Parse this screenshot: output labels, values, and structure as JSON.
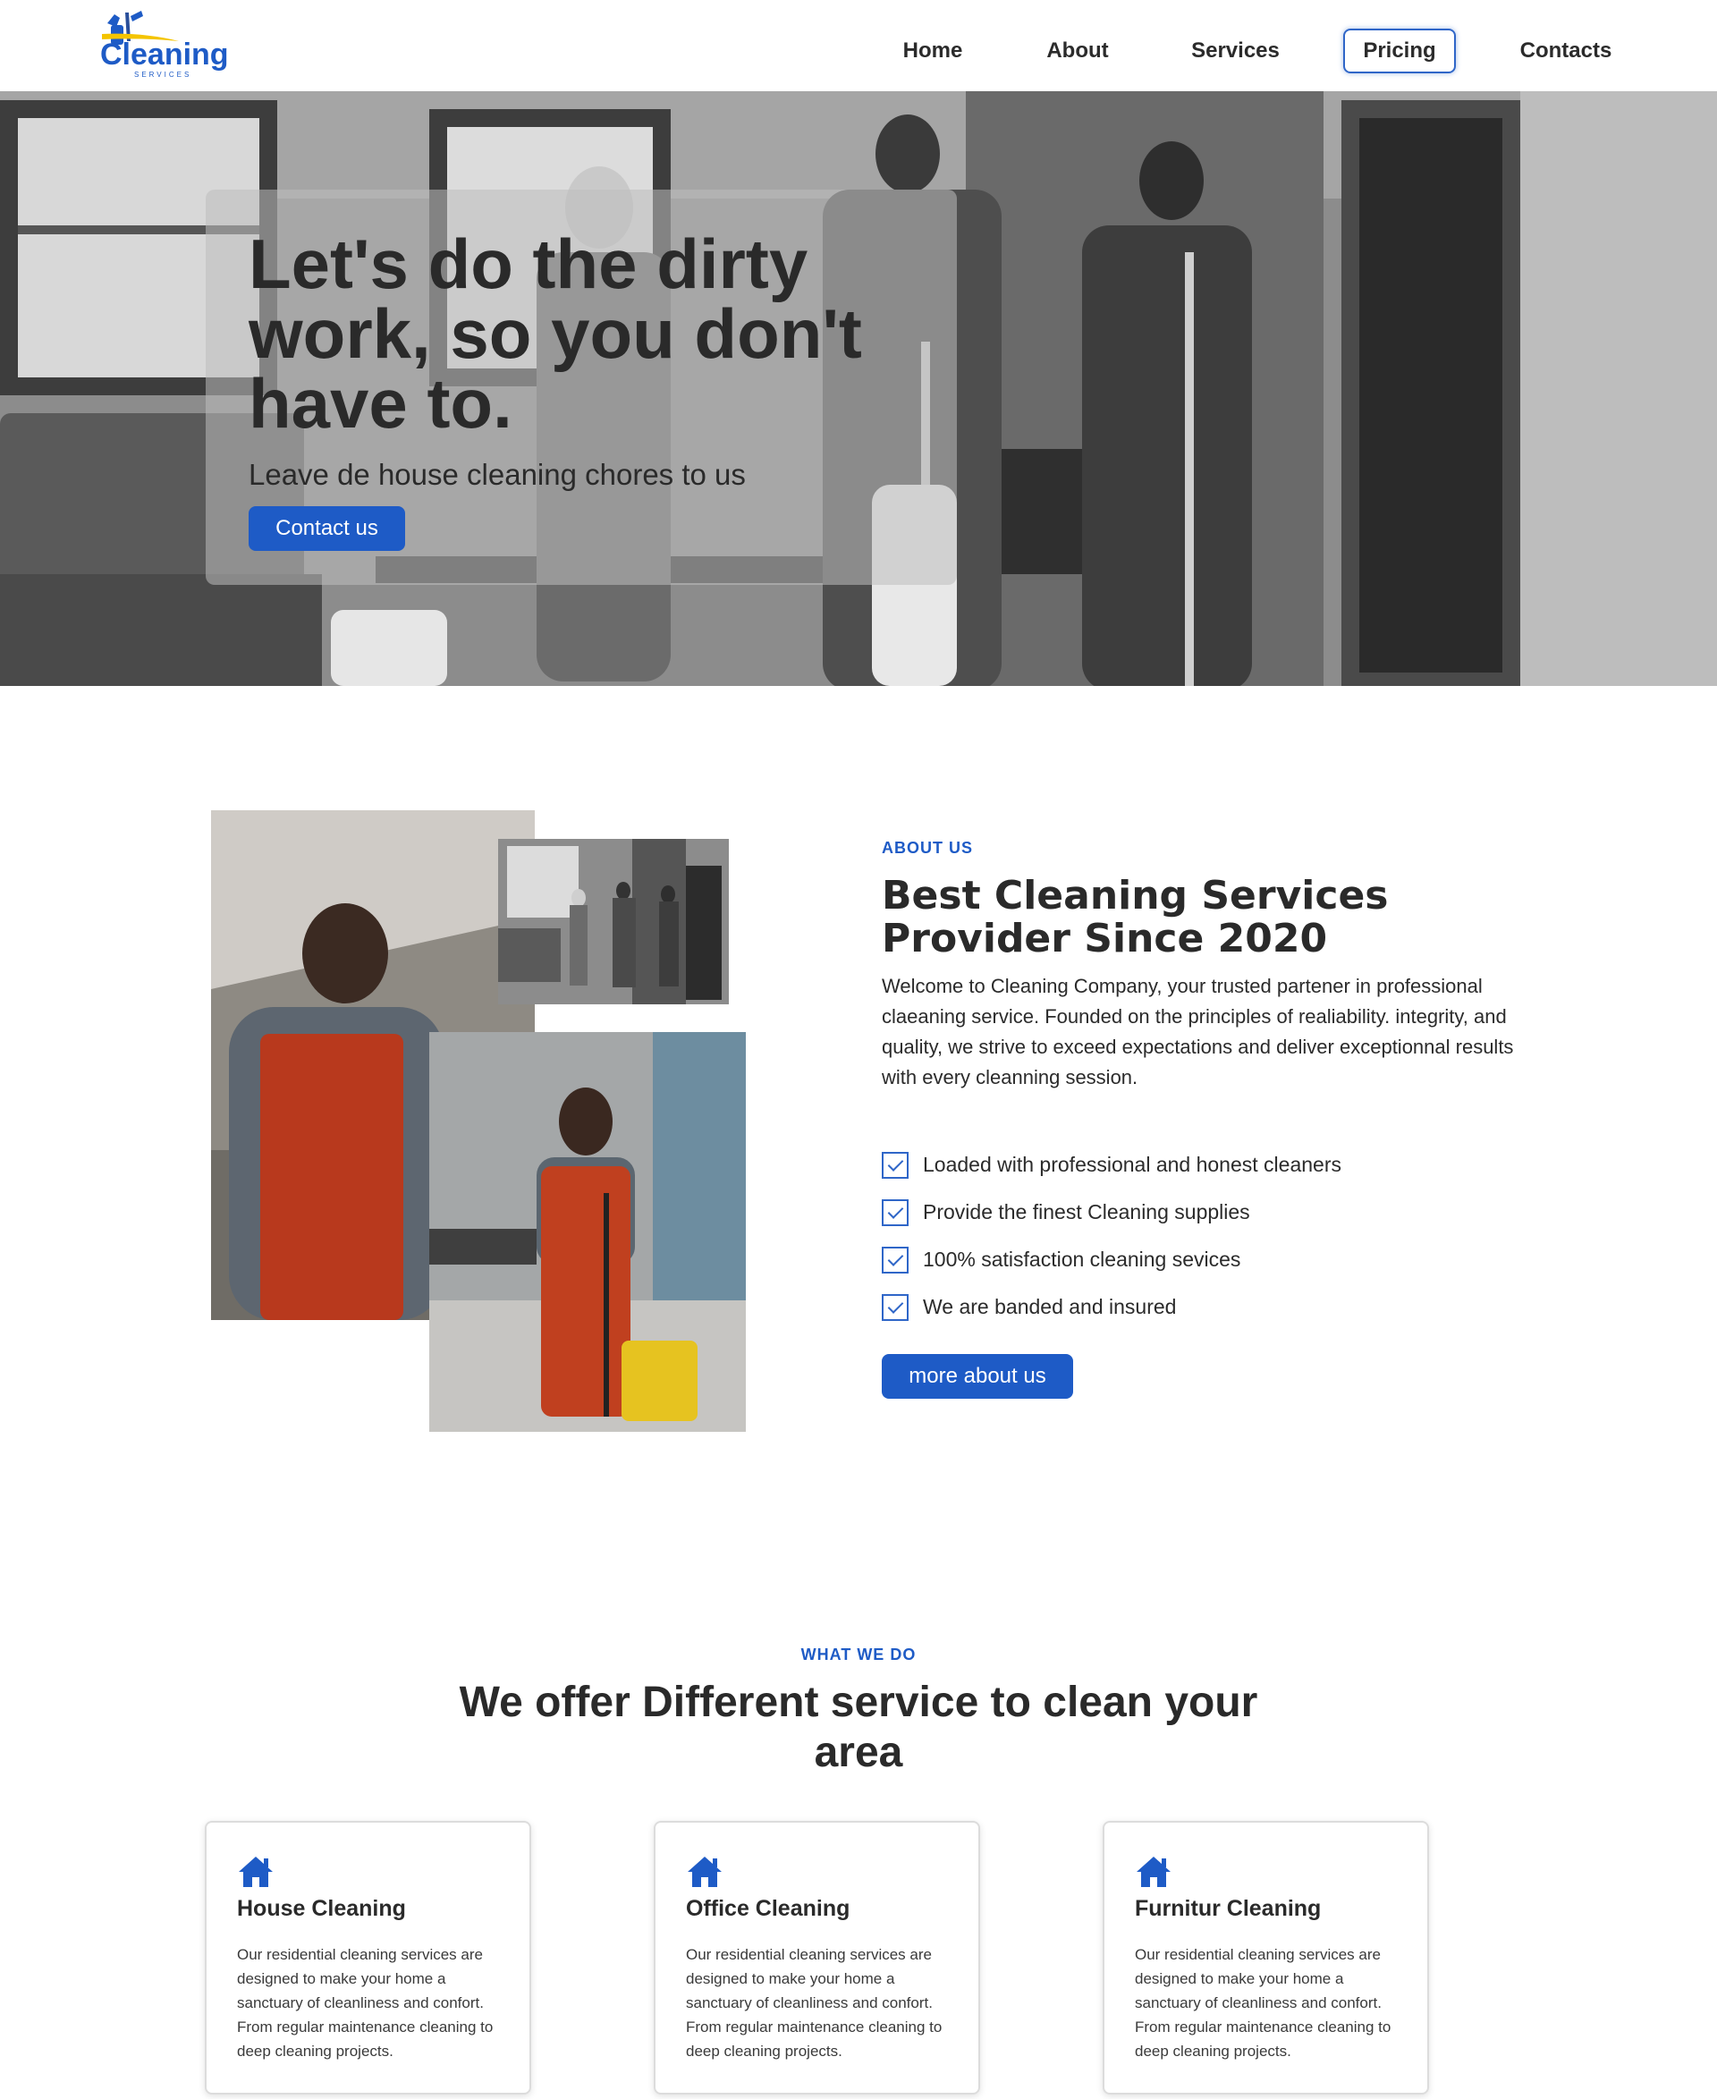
{
  "brand": {
    "logo_word": "Cleaning",
    "logo_tagline": "SERVICES",
    "primary_color": "#1e5bc6"
  },
  "nav": {
    "items": [
      {
        "label": "Home"
      },
      {
        "label": "About"
      },
      {
        "label": "Services"
      },
      {
        "label": "Pricing",
        "active": true
      },
      {
        "label": "Contacts"
      }
    ]
  },
  "hero": {
    "title": "Let's do the dirty work, so you don't have to.",
    "subtitle": "Leave de house cleaning chores to us",
    "cta_label": "Contact us"
  },
  "about": {
    "eyebrow": "ABOUT US",
    "title": "Best Cleaning Services Provider Since 2020",
    "text": "Welcome to Cleaning Company, your trusted partener in professional claeaning service. Founded on the principles of realiability. integrity, and quality, we strive to exceed expectations and deliver exceptionnal results with every cleanning session.",
    "checklist": [
      "Loaded with professional and honest cleaners",
      "Provide the finest Cleaning supplies",
      "100% satisfaction cleaning sevices",
      "We are banded and insured"
    ],
    "cta_label": "more about us"
  },
  "services": {
    "eyebrow": "WHAT WE DO",
    "title": "We offer Different service to clean your area",
    "cards": [
      {
        "icon": "house-icon",
        "title": "House Cleaning",
        "text": "Our residential cleaning services are designed to make your home a sanctuary of cleanliness and confort. From regular maintenance cleaning to deep cleaning projects."
      },
      {
        "icon": "house-icon",
        "title": "Office Cleaning",
        "text": "Our residential cleaning services are designed to make your home a sanctuary of cleanliness and confort. From regular maintenance cleaning to deep cleaning projects."
      },
      {
        "icon": "house-icon",
        "title": "Furnitur Cleaning",
        "text": "Our residential cleaning services are designed to make your home a sanctuary of cleanliness and confort. From regular maintenance cleaning to deep cleaning projects."
      }
    ]
  }
}
